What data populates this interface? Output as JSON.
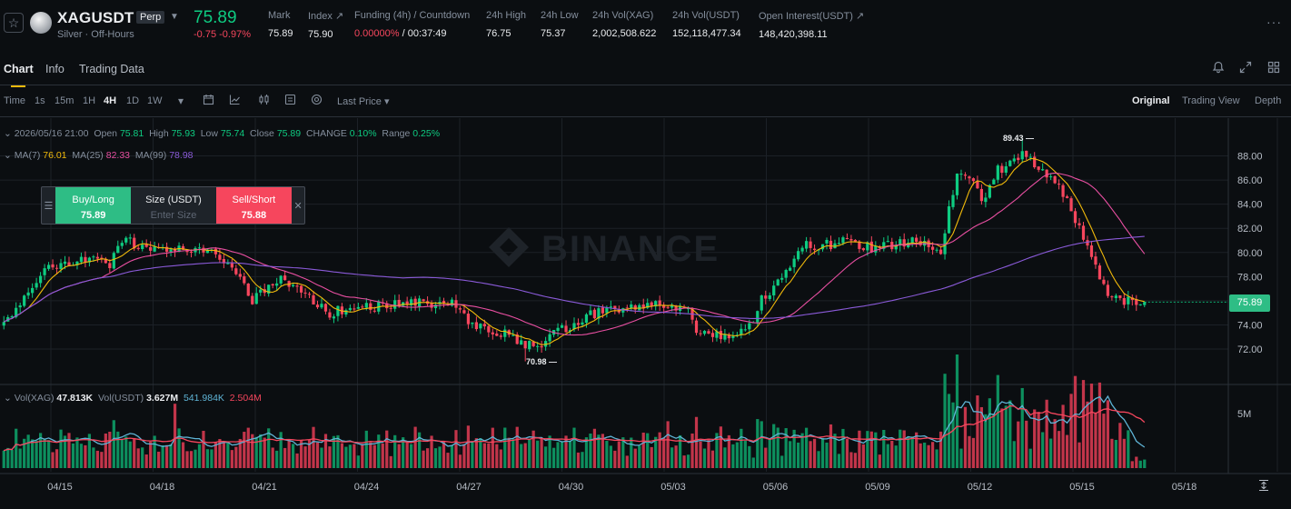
{
  "header": {
    "star_icon": "star-icon",
    "symbol": "XAGUSDT",
    "badge": "Perp",
    "subtitle": "Silver · Off-Hours",
    "last_price": "75.89",
    "change": "-0.75 -0.97%",
    "stats": [
      {
        "label": "Mark",
        "value": "75.89"
      },
      {
        "label": "Index ↗",
        "value": "75.90"
      },
      {
        "label": "Funding (4h) / Countdown",
        "value_red": "0.00000%",
        "value_rest": " / 00:37:49"
      },
      {
        "label": "24h High",
        "value": "76.75"
      },
      {
        "label": "24h Low",
        "value": "75.37"
      },
      {
        "label": "24h Vol(XAG)",
        "value": "2,002,508.622"
      },
      {
        "label": "24h Vol(USDT)",
        "value": "152,118,477.34"
      },
      {
        "label": "Open Interest(USDT) ↗",
        "value": "148,420,398.11"
      }
    ],
    "more": "···"
  },
  "tabs": [
    "Chart",
    "Info",
    "Trading Data"
  ],
  "toolbar": {
    "time_label": "Time",
    "intervals": [
      "1s",
      "15m",
      "1H",
      "4H",
      "1D",
      "1W"
    ],
    "active_interval": "4H",
    "price_type": "Last Price ▾",
    "views": [
      "Original",
      "Trading View",
      "Depth"
    ],
    "active_view": "Original"
  },
  "legend": {
    "ohlc": {
      "time": "2026/05/16 21:00",
      "open_label": "Open",
      "open": "75.81",
      "high_label": "High",
      "high": "75.93",
      "low_label": "Low",
      "low": "75.74",
      "close_label": "Close",
      "close": "75.89",
      "change_label": "CHANGE",
      "change": "0.10%",
      "range_label": "Range",
      "range": "0.25%"
    },
    "ma": {
      "ma7_label": "MA(7)",
      "ma7": "76.01",
      "ma25_label": "MA(25)",
      "ma25": "82.33",
      "ma99_label": "MA(99)",
      "ma99": "78.98"
    },
    "vol": {
      "vol_xag_label": "Vol(XAG)",
      "vol_xag": "47.813K",
      "vol_usdt_label": "Vol(USDT)",
      "vol_usdt": "3.627M",
      "ma_a": "541.984K",
      "ma_b": "2.504M"
    }
  },
  "order_widget": {
    "buy_label": "Buy/Long",
    "buy_price": "75.89",
    "size_label": "Size (USDT)",
    "size_placeholder": "Enter Size",
    "sell_label": "Sell/Short",
    "sell_price": "75.88"
  },
  "watermark": "BINANCE",
  "current_price_tag": "75.89",
  "markers": {
    "high": "89.43",
    "low": "70.98"
  },
  "colors": {
    "up": "#0ecb81",
    "down": "#f6465d",
    "ma7": "#f0b90b",
    "ma25": "#e84fa1",
    "ma99": "#8a5ad8",
    "vol_ma_a": "#5fb4d6",
    "vol_ma_b": "#f6465d"
  },
  "chart_data": {
    "type": "candlestick",
    "interval": "4H",
    "price_axis": [
      "88.00",
      "86.00",
      "84.00",
      "82.00",
      "80.00",
      "78.00",
      "76.00",
      "74.00",
      "72.00"
    ],
    "price_range": [
      70.0,
      90.0
    ],
    "volume_axis": [
      "5M"
    ],
    "volume_max": 7.0,
    "date_labels": [
      "04/15",
      "04/18",
      "04/21",
      "04/24",
      "04/27",
      "04/30",
      "05/03",
      "05/06",
      "05/09",
      "05/12",
      "05/15",
      "05/18"
    ],
    "close_anchors": [
      [
        0,
        74.0
      ],
      [
        10,
        78.8
      ],
      [
        20,
        79.4
      ],
      [
        26,
        79.0
      ],
      [
        28,
        80.5
      ],
      [
        30,
        81.5
      ],
      [
        33,
        80.3
      ],
      [
        40,
        80.5
      ],
      [
        52,
        80.0
      ],
      [
        58,
        78.0
      ],
      [
        61,
        76.0
      ],
      [
        68,
        78.0
      ],
      [
        74,
        76.5
      ],
      [
        80,
        75.0
      ],
      [
        86,
        75.5
      ],
      [
        95,
        75.6
      ],
      [
        104,
        75.8
      ],
      [
        110,
        75.7
      ],
      [
        116,
        73.8
      ],
      [
        124,
        73.2
      ],
      [
        128,
        72.2
      ],
      [
        132,
        72.5
      ],
      [
        136,
        73.4
      ],
      [
        144,
        74.8
      ],
      [
        152,
        75.5
      ],
      [
        160,
        75.6
      ],
      [
        168,
        75.4
      ],
      [
        170,
        73.2
      ],
      [
        174,
        73.0
      ],
      [
        182,
        73.3
      ],
      [
        186,
        76.0
      ],
      [
        192,
        78.5
      ],
      [
        196,
        80.8
      ],
      [
        200,
        80.5
      ],
      [
        206,
        80.8
      ],
      [
        212,
        80.4
      ],
      [
        220,
        80.7
      ],
      [
        226,
        81.0
      ],
      [
        230,
        80.3
      ],
      [
        234,
        86.5
      ],
      [
        238,
        86.0
      ],
      [
        240,
        84.0
      ],
      [
        244,
        86.8
      ],
      [
        248,
        87.5
      ],
      [
        250,
        88.4
      ],
      [
        254,
        87.0
      ],
      [
        258,
        86.0
      ],
      [
        262,
        83.5
      ],
      [
        266,
        80.6
      ],
      [
        270,
        77.0
      ],
      [
        274,
        76.1
      ],
      [
        280,
        75.9
      ]
    ],
    "count": 281,
    "high": 89.43,
    "low": 70.98
  }
}
